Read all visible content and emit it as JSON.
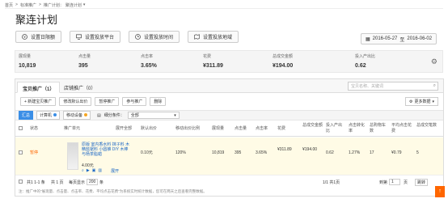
{
  "breadcrumb": {
    "home": "首页",
    "sep": ">",
    "ads": "标准推广",
    "plan_label": "推广计划：",
    "plan_value": "聚连计划"
  },
  "page_title": "聚连计划",
  "actions": [
    "设置日限额",
    "设置投放平台",
    "设置投放时间",
    "设置投放地域"
  ],
  "date_range": {
    "start": "2016-05-27",
    "to": "至",
    "end": "2016-06-02"
  },
  "stats": [
    {
      "label": "展现量",
      "value": "10,819"
    },
    {
      "label": "点击量",
      "value": "395"
    },
    {
      "label": "点击率",
      "value": "3.65%"
    },
    {
      "label": "花费",
      "value": "¥311.89"
    },
    {
      "label": "总成交金额",
      "value": "¥194.00"
    },
    {
      "label": "投入产出比",
      "value": "0.62"
    }
  ],
  "tabs": [
    "宝贝推广（1）",
    "店铺推广（0）"
  ],
  "search_placeholder": "宝贝名称、关键词",
  "toolbar": [
    "+ 新建宝贝推广",
    "修改默认出价",
    "暂停推广",
    "参与推广",
    "删除"
  ],
  "more_data": "更多数据",
  "filters": {
    "all": "汇总",
    "pc": "计算机",
    "mobile": "移动设备",
    "status_label": "细分条件：",
    "status_value": "全部"
  },
  "colors": {
    "accent": "#3a8ee6",
    "paused": "#ff6600",
    "row_bg": "#fffbe6",
    "mobile_dot": "#f5a623",
    "pc_dot": "#3a8ee6"
  },
  "table": {
    "headers": [
      "状态",
      "推广单元",
      "展开全部",
      "默认出价",
      "移动出价比例",
      "展现量",
      "点击量",
      "点击率",
      "花费",
      "总成交金额",
      "投入产出比",
      "点击转化率",
      "总购物车数",
      "平均点击花费",
      "总成交笔数"
    ],
    "row": {
      "status": "暂停",
      "name": "原版 室内香水料 抹子料 木精盐锯料 小圆锥 DIY 木棒与杨茶脂蜡",
      "price": "4.00元",
      "expand": "展开",
      "bid": "0.10元",
      "mobile_ratio": "120%",
      "impressions": "10,819",
      "clicks": "395",
      "ctr": "3.65%",
      "cost": "¥311.89",
      "gmv": "¥194.00",
      "roi": "0.62",
      "cvr": "1.27%",
      "carts": "17",
      "cpc": "¥0.79",
      "orders": "5"
    }
  },
  "footer": {
    "total": "共1 1-1 条",
    "pages": "共 1 页",
    "per_page_label": "每页显示",
    "per_page": "200",
    "per_page_unit": "条",
    "page_info": "1/1 共1页",
    "goto_label": "到第",
    "goto_value": "1",
    "goto_unit": "页",
    "goto_btn": "跳转"
  },
  "note": "注：推广中的\"展现量、点击量、点击率、花费、平均点击花费\"为系统实时统计数据，您可在两天之后查看完整数据。"
}
